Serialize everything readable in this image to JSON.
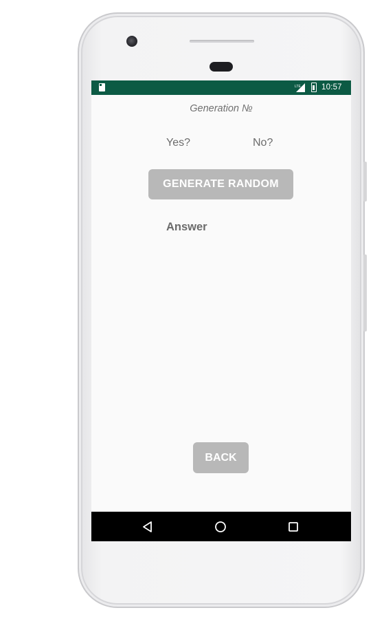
{
  "status_bar": {
    "time": "10:57",
    "icons": [
      "sd-card-icon",
      "signal-icon",
      "battery-icon"
    ],
    "background_color": "#0c5a44"
  },
  "main": {
    "title": "Generation №",
    "yes_label": "Yes?",
    "no_label": "No?",
    "generate_button_label": "GENERATE RANDOM",
    "answer_label": "Answer",
    "back_button_label": "BACK",
    "button_color": "#b8b8b8"
  },
  "nav_bar": {
    "icons": [
      "back-triangle-icon",
      "home-circle-icon",
      "recents-square-icon"
    ]
  }
}
